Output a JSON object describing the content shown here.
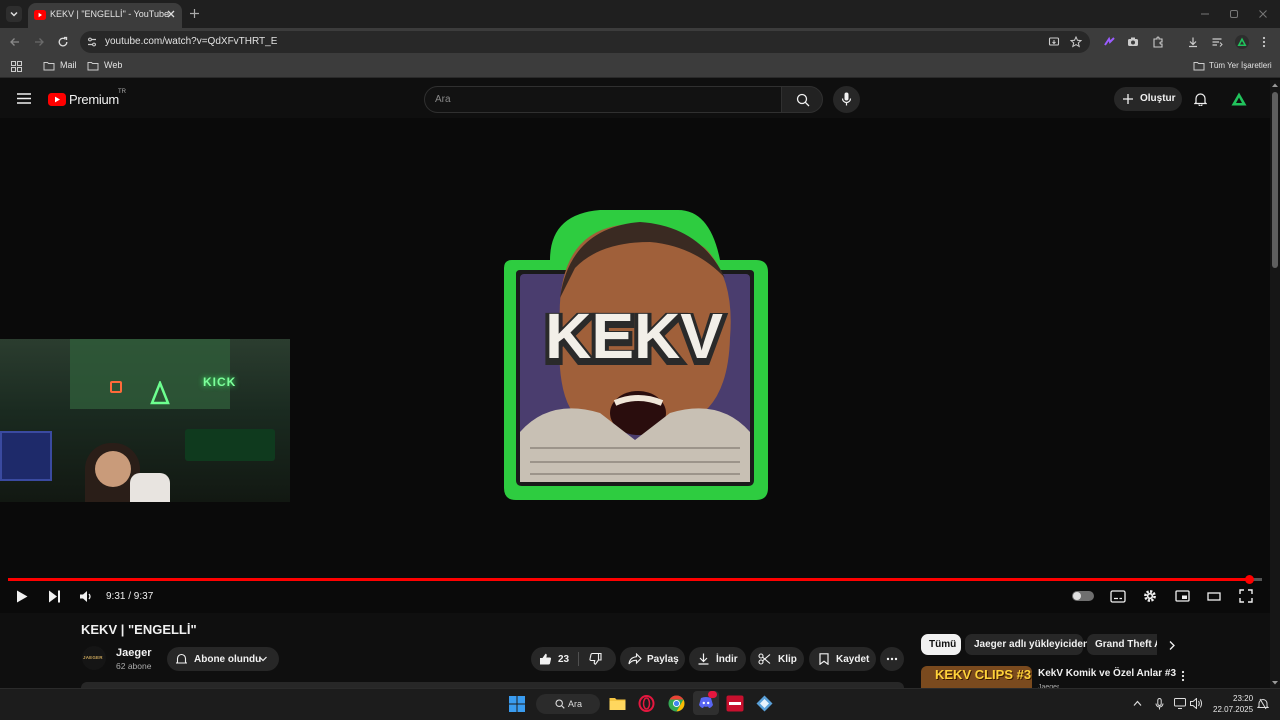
{
  "browser": {
    "tab_title": "KEKV | \"ENGELLİ\" - YouTube",
    "url": "youtube.com/watch?v=QdXFvTHRT_E",
    "bookmarks": [
      "Mail",
      "Web"
    ],
    "all_bookmarks": "Tüm Yer İşaretleri"
  },
  "youtube": {
    "logo_text": "Premium",
    "logo_region": "TR",
    "search_placeholder": "Ara",
    "create_label": "Oluştur"
  },
  "player": {
    "overlay_text": "KEKV",
    "time": "9:31 / 9:37",
    "progress": 0.9893,
    "webcam_sign": "KICK"
  },
  "video": {
    "title": "KEKV | \"ENGELLİ\"",
    "channel_name": "Jaeger",
    "channel_avatar_text": "JAEGER",
    "subscribers": "62 abone",
    "subscribed_label": "Abone olundu",
    "likes": "23",
    "share_label": "Paylaş",
    "download_label": "İndir",
    "clip_label": "Klip",
    "save_label": "Kaydet"
  },
  "chips": [
    "Tümü",
    "Jaeger adlı yükleyiciden",
    "Grand Theft A"
  ],
  "recommendation": {
    "title": "KekV Komik ve Özel Anlar #3",
    "thumb_text": "KEKV CLIPS #3",
    "channel": "Jaeger"
  },
  "taskbar": {
    "search_label": "Ara",
    "time": "23:20",
    "date": "22.07.2025"
  },
  "colors": {
    "brand_red": "#ff0000",
    "kekv_green": "#2ecc40",
    "accent_green": "#21c35c"
  }
}
